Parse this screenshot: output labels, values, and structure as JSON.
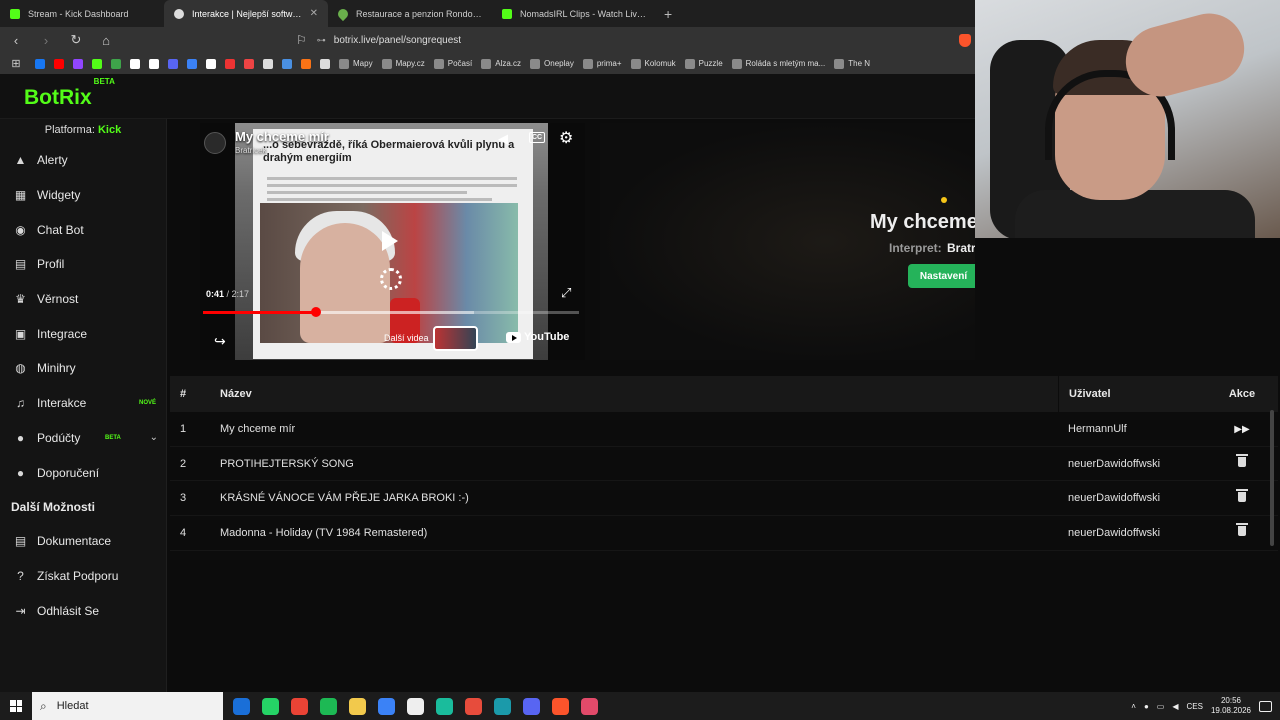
{
  "browser": {
    "tabs": [
      {
        "title": "Stream - Kick Dashboard",
        "favicon": "kick-icon",
        "active": false
      },
      {
        "title": "Interakce | Nejlepší software pro",
        "favicon": "botrix-icon",
        "active": true
      },
      {
        "title": "Restaurace a penzion Rondo – Mapy",
        "favicon": "map-pin-icon",
        "active": false
      },
      {
        "title": "NomadsIRL Clips - Watch Live on Kic",
        "favicon": "kick-icon",
        "active": false
      }
    ],
    "new_tab": "+",
    "url": "botrix.live/panel/songrequest",
    "bookmarks": [
      "Mapy",
      "Mapy.cz",
      "Počasí",
      "Alza.cz",
      "Oneplay",
      "prima+",
      "Kolomuk",
      "Puzzle",
      "Roláda s mletým ma...",
      "The N"
    ],
    "bookmark_colors": [
      "#1877f2",
      "#ff0000",
      "#9146ff",
      "#53fc18",
      "#3ea34a",
      "#ffffff",
      "#ffffff",
      "#5865f2",
      "#3b82f6",
      "#ffffff",
      "#e33",
      "#e44",
      "#ddd",
      "#4a90e2",
      "#f97316",
      "#ddd"
    ]
  },
  "app": {
    "logo": "BotRix",
    "logo_badge": "BETA",
    "platform_label": "Platforma:",
    "platform_value": "Kick",
    "nav": [
      {
        "label": "Alerty",
        "icon": "warning-icon",
        "glyph": "▲"
      },
      {
        "label": "Widgety",
        "icon": "widgets-icon",
        "glyph": "▦"
      },
      {
        "label": "Chat Bot",
        "icon": "robot-icon",
        "glyph": "◉"
      },
      {
        "label": "Profil",
        "icon": "profile-card-icon",
        "glyph": "▤"
      },
      {
        "label": "Věrnost",
        "icon": "trophy-icon",
        "glyph": "♛"
      },
      {
        "label": "Integrace",
        "icon": "integration-icon",
        "glyph": "▣"
      },
      {
        "label": "Minihry",
        "icon": "gamepad-icon",
        "glyph": "◍"
      },
      {
        "label": "Interakce",
        "icon": "music-icon",
        "glyph": "♫",
        "badge": "NOVÉ"
      },
      {
        "label": "Podúčty",
        "icon": "users-icon",
        "glyph": "●",
        "badge": "BETA",
        "chevron": "⌄"
      },
      {
        "label": "Doporučení",
        "icon": "referral-icon",
        "glyph": "●"
      }
    ],
    "more_section": "Další Možnosti",
    "more_nav": [
      {
        "label": "Dokumentace",
        "icon": "document-icon",
        "glyph": "▤"
      },
      {
        "label": "Získat Podporu",
        "icon": "help-icon",
        "glyph": "?"
      },
      {
        "label": "Odhlásit Se",
        "icon": "logout-icon",
        "glyph": "⇥"
      }
    ]
  },
  "player": {
    "title": "My chceme mír",
    "channel": "Bratricek",
    "article_headline": "...o sebevraždě, říká Obermaierová kvůli plynu a drahým energiím",
    "current_time": "0:41",
    "duration": "2:17",
    "progress": 0.3,
    "buffered": 0.72,
    "more_videos": "Další videa",
    "youtube": "YouTube"
  },
  "now_playing": {
    "title": "My chceme",
    "artist_label": "Interpret:",
    "artist": "Bratricek",
    "settings_button": "Nastavení"
  },
  "queue": {
    "headers": {
      "num": "#",
      "name": "Název",
      "user": "Uživatel",
      "actions": "Akce"
    },
    "rows": [
      {
        "num": "1",
        "name": "My chceme mír",
        "user": "HermannUlf",
        "action": "skip-icon"
      },
      {
        "num": "2",
        "name": "PROTIHEJTERSKÝ SONG",
        "user": "neuerDawidoffwski",
        "action": "trash-icon"
      },
      {
        "num": "3",
        "name": "KRÁSNÉ VÁNOCE VÁM PŘEJE JARKA BROKI :-)",
        "user": "neuerDawidoffwski",
        "action": "trash-icon"
      },
      {
        "num": "4",
        "name": "Madonna - Holiday (TV 1984 Remastered)",
        "user": "neuerDawidoffwski",
        "action": "trash-icon"
      }
    ]
  },
  "taskbar": {
    "search_placeholder": "Hledat",
    "language": "CES",
    "time": "20:56",
    "date": "19.08.2026",
    "app_colors": [
      "#1a6fd8",
      "#25d366",
      "#ea4335",
      "#1db954",
      "#f2c94c",
      "#3b82f6",
      "#eee",
      "#1abc9c",
      "#e74c3c",
      "#1b9aaa",
      "#5865f2",
      "#fb542b",
      "#e24a6a"
    ]
  },
  "colors": {
    "accent": "#53fc18",
    "button": "#25b35a",
    "progress": "#ff0000"
  }
}
